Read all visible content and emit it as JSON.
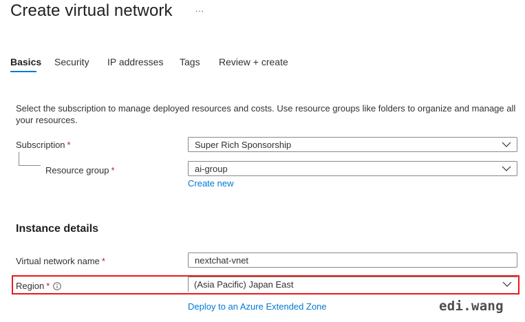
{
  "header": {
    "title": "Create virtual network",
    "more_icon": "more-ellipsis-icon",
    "more_glyph": "···"
  },
  "tabs": [
    {
      "label": "Basics",
      "active": true
    },
    {
      "label": "Security",
      "active": false
    },
    {
      "label": "IP addresses",
      "active": false
    },
    {
      "label": "Tags",
      "active": false
    },
    {
      "label": "Review + create",
      "active": false
    }
  ],
  "description": "Select the subscription to manage deployed resources and costs. Use resource groups like folders to organize and manage all your resources.",
  "project_details": {
    "subscription": {
      "label": "Subscription",
      "required_mark": "*",
      "value": "Super Rich Sponsorship"
    },
    "resource_group": {
      "label": "Resource group",
      "required_mark": "*",
      "value": "ai-group",
      "create_new_link": "Create new"
    }
  },
  "instance_details": {
    "heading": "Instance details",
    "vnet_name": {
      "label": "Virtual network name",
      "required_mark": "*",
      "value": "nextchat-vnet"
    },
    "region": {
      "label": "Region",
      "required_mark": "*",
      "info_icon": "info-icon",
      "value": "(Asia Pacific) Japan East",
      "extended_zone_link": "Deploy to an Azure Extended Zone"
    }
  },
  "watermark": "edi.wang",
  "colors": {
    "accent_link": "#0078d4",
    "required": "#a4262c",
    "highlight_box": "#e8181b",
    "border": "#8a8886"
  }
}
